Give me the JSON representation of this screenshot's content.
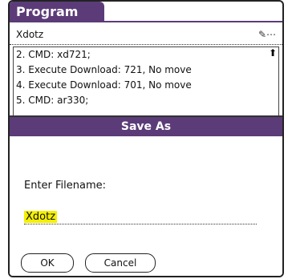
{
  "title": "Program",
  "field": {
    "value": "Xdotz",
    "icon": "edit-icon"
  },
  "list": {
    "items": [
      "2. CMD: xd721;",
      "3. Execute Download: 721, No move",
      "4. Execute Download: 701, No move",
      "5. CMD: ar330;"
    ],
    "scroll_glyph": "⬆"
  },
  "dialog": {
    "title": "Save As",
    "prompt": "Enter Filename:",
    "filename": "Xdotz",
    "ok_label": "OK",
    "cancel_label": "Cancel"
  },
  "colors": {
    "accent": "#5c3c78",
    "highlight": "#f5f000"
  }
}
